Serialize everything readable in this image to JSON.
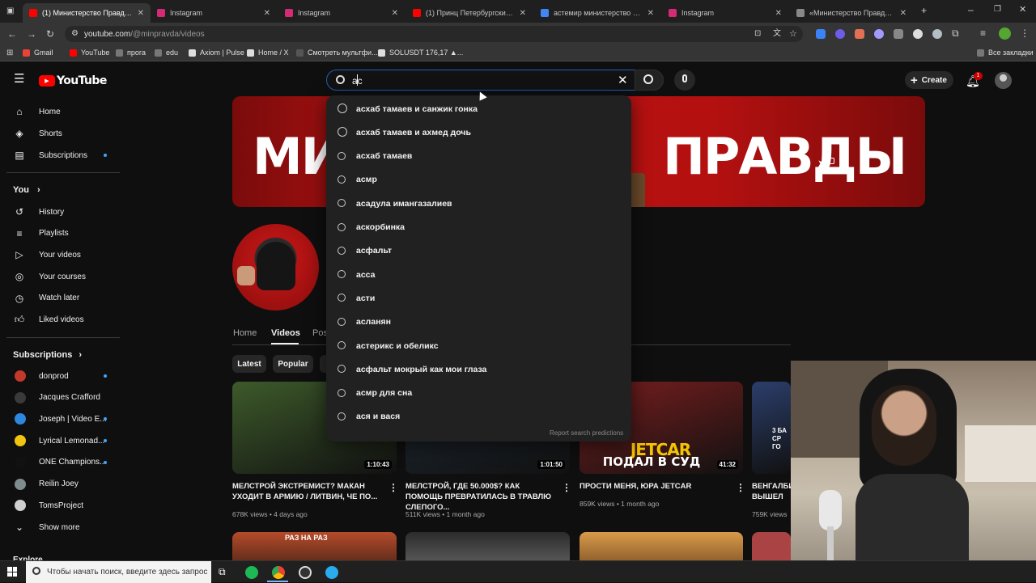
{
  "browser": {
    "tabs": [
      {
        "title": "(1) Министерство Правды - Yo",
        "color": "#ff0000",
        "active": true
      },
      {
        "title": "Instagram",
        "color": "#d62976",
        "active": false
      },
      {
        "title": "Instagram",
        "color": "#d62976",
        "active": false
      },
      {
        "title": "(1) Принц Петербургский - Yo",
        "color": "#ff0000",
        "active": false
      },
      {
        "title": "астемир министерство правд",
        "color": "#4285f4",
        "active": false
      },
      {
        "title": "Instagram",
        "color": "#d62976",
        "active": false
      },
      {
        "title": "«Министерство Правды» вып",
        "color": "#888888",
        "active": false
      }
    ],
    "new_tab": "+",
    "window_controls": {
      "minimize": "–",
      "maximize": "❐",
      "close": "✕"
    },
    "url_host": "youtube.com",
    "url_path": "/@minpravda/videos",
    "bookmarks": [
      {
        "label": "Gmail",
        "color": "#ea4335"
      },
      {
        "label": "YouTube",
        "color": "#ff0000"
      },
      {
        "label": "прога",
        "color": "#777777"
      },
      {
        "label": "edu",
        "color": "#777777"
      },
      {
        "label": "Axiom | Pulse",
        "color": "#dddddd"
      },
      {
        "label": "Home / X",
        "color": "#dddddd"
      },
      {
        "label": "Смотреть мультфи...",
        "color": "#555555"
      },
      {
        "label": "SOLUSDT 176,17 ▲...",
        "color": "#dddddd"
      }
    ],
    "all_bookmarks": "Все закладки"
  },
  "youtube": {
    "logo": "YouTube",
    "search": {
      "value": "ас",
      "suggestions": [
        {
          "text": "асхаб тамаев и санжик гонка",
          "history": true
        },
        {
          "text": "асхаб тамаев и ахмед дочь",
          "history": true
        },
        {
          "text": "асхаб тамаев",
          "history": false
        },
        {
          "text": "асмр",
          "history": false
        },
        {
          "text": "асадула имангазалиев",
          "history": false
        },
        {
          "text": "аскорбинка",
          "history": false
        },
        {
          "text": "асфальт",
          "history": false
        },
        {
          "text": "асса",
          "history": false
        },
        {
          "text": "асти",
          "history": false
        },
        {
          "text": "асланян",
          "history": false
        },
        {
          "text": "астерикс и обеликс",
          "history": false
        },
        {
          "text": "асфальт мокрый как мои глаза",
          "history": false
        },
        {
          "text": "асмр для сна",
          "history": false
        },
        {
          "text": "ася и вася",
          "history": false
        }
      ],
      "report": "Report search predictions"
    },
    "create_label": "Create",
    "notif_count": "1",
    "sidebar": {
      "main": [
        {
          "label": "Home",
          "icon": "home-icon"
        },
        {
          "label": "Shorts",
          "icon": "shorts-icon"
        },
        {
          "label": "Subscriptions",
          "icon": "subscriptions-icon"
        }
      ],
      "you_header": "You",
      "you": [
        {
          "label": "History",
          "icon": "history-icon"
        },
        {
          "label": "Playlists",
          "icon": "playlists-icon"
        },
        {
          "label": "Your videos",
          "icon": "your-videos-icon"
        },
        {
          "label": "Your courses",
          "icon": "courses-icon"
        },
        {
          "label": "Watch later",
          "icon": "watch-later-icon"
        },
        {
          "label": "Liked videos",
          "icon": "like-icon"
        }
      ],
      "subs_header": "Subscriptions",
      "subs": [
        {
          "label": "donprod",
          "color": "#c0392b",
          "dot": true
        },
        {
          "label": "Jacques Crafford",
          "color": "#3a3a3a",
          "dot": false
        },
        {
          "label": "Joseph | Video E...",
          "color": "#2e86de",
          "dot": true
        },
        {
          "label": "Lyrical Lemonad...",
          "color": "#f1c40f",
          "dot": true
        },
        {
          "label": "ONE Champions...",
          "color": "#111111",
          "dot": true
        },
        {
          "label": "Reilin Joey",
          "color": "#7f8c8d",
          "dot": false
        },
        {
          "label": "TomsProject",
          "color": "#d0d0d0",
          "dot": false
        }
      ],
      "show_more": "Show more",
      "explore": "Explore"
    },
    "banner": {
      "left": "МИНИ",
      "right": "ПРАВДЫ"
    },
    "channel_tabs": [
      "Home",
      "Videos",
      "Pos"
    ],
    "chips": [
      "Latest",
      "Popular",
      ""
    ],
    "videos": [
      {
        "title": "МЕЛСТРОЙ ЭКСТРЕМИСТ? МАКАН УХОДИТ В АРМИЮ / ЛИТВИН, ЧЕ ПО...",
        "views": "678K views",
        "age": "4 days ago",
        "duration": "1:10:43",
        "bg": "#3d5a2a"
      },
      {
        "title": "МЕЛСТРОЙ, ГДЕ 50.000$? КАК ПОМОЩЬ ПРЕВРАТИЛАСЬ В ТРАВЛЮ СЛЕПОГО...",
        "views": "511K views",
        "age": "1 month ago",
        "duration": "1:01:50",
        "bg": "#1e2a36"
      },
      {
        "title": "ПРОСТИ МЕНЯ, ЮРА JETCAR",
        "views": "859K views",
        "age": "1 month ago",
        "duration": "41:32",
        "bg": "#7a1e1e"
      },
      {
        "title": "ВЕНГАЛБИ ВЫШЕЛ ИЗ",
        "views": "759K views",
        "age": "",
        "duration": "",
        "bg": "#2b3e6b"
      }
    ],
    "thumb_overlay": {
      "jetcar": "JETCAR",
      "jetcar_sub": "ПОДАЛ В СУД",
      "raz": "РАЗ НА РАЗ",
      "side": "3 БА СР ГО"
    }
  },
  "taskbar": {
    "search_placeholder": "Чтобы начать поиск, введите здесь запрос"
  }
}
